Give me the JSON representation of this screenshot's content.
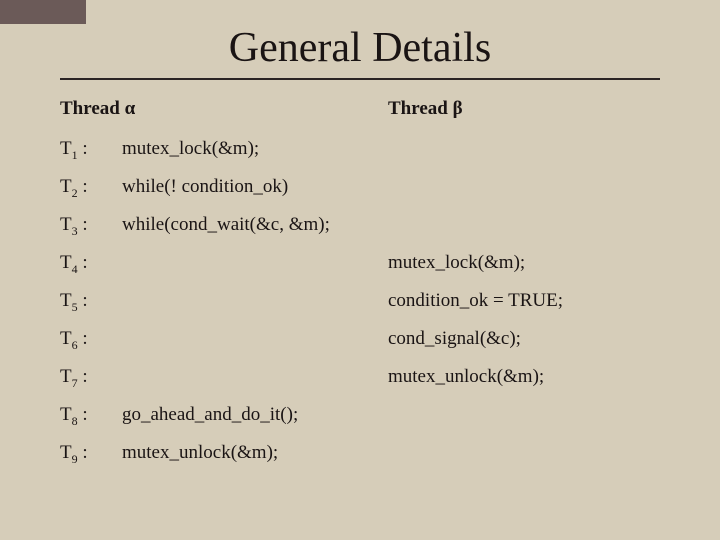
{
  "title": "General Details",
  "headers": {
    "alpha_prefix": "Thread ",
    "alpha_sym": "α",
    "beta_prefix": "Thread ",
    "beta_sym": "β"
  },
  "rows": [
    {
      "label": "T",
      "sub": "1",
      "suffix": " :",
      "a": "mutex_lock(&m);",
      "b": ""
    },
    {
      "label": "T",
      "sub": "2",
      "suffix": " :",
      "a": "while(! condition_ok)",
      "b": ""
    },
    {
      "label": "T",
      "sub": "3",
      "suffix": " :",
      "a": "while(cond_wait(&c, &m);",
      "b": ""
    },
    {
      "label": "T",
      "sub": "4",
      "suffix": " :",
      "a": "",
      "b": "mutex_lock(&m);"
    },
    {
      "label": "T",
      "sub": "5",
      "suffix": " :",
      "a": "",
      "b": "condition_ok = TRUE;"
    },
    {
      "label": "T",
      "sub": "6",
      "suffix": " :",
      "a": "",
      "b": "cond_signal(&c);"
    },
    {
      "label": "T",
      "sub": "7",
      "suffix": " :",
      "a": "",
      "b": "mutex_unlock(&m);"
    },
    {
      "label": "T",
      "sub": "8",
      "suffix": " :",
      "a": "go_ahead_and_do_it();",
      "b": ""
    },
    {
      "label": "T",
      "sub": "9",
      "suffix": " :",
      "a": "mutex_unlock(&m);",
      "b": ""
    }
  ]
}
